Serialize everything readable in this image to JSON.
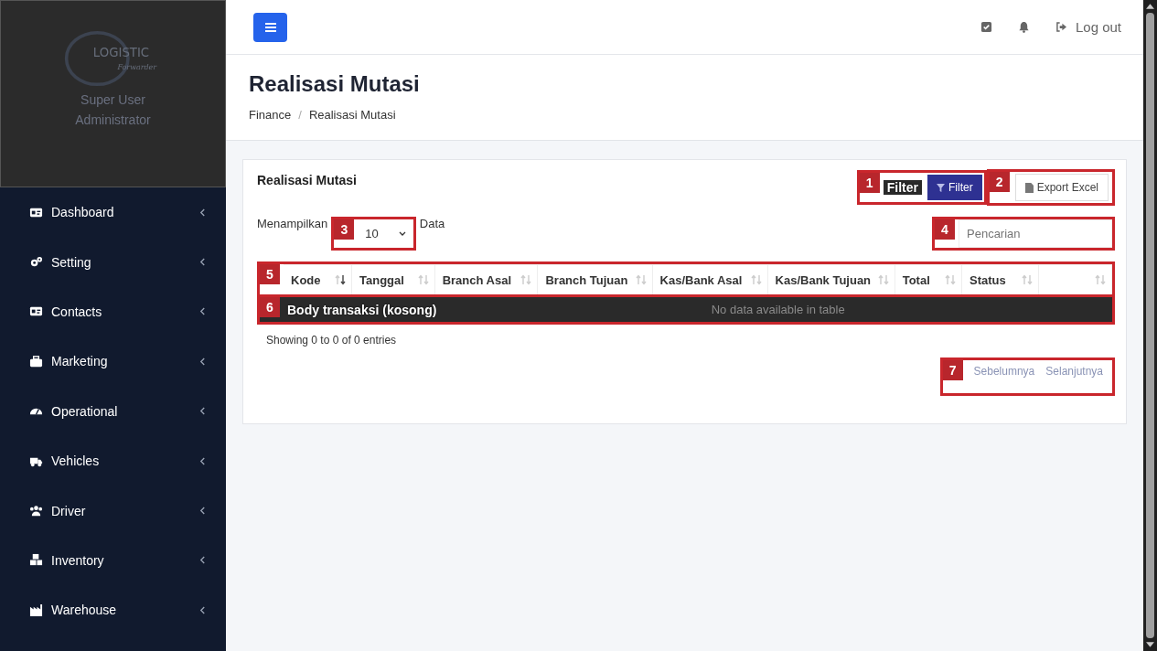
{
  "sidebar": {
    "logo_text": "LOGISTIC",
    "logo_subtext": "Forwarder",
    "user_name": "Super User",
    "user_role": "Administrator",
    "items": [
      {
        "label": "Dashboard",
        "expanded": false
      },
      {
        "label": "Setting",
        "expanded": false
      },
      {
        "label": "Contacts",
        "expanded": false
      },
      {
        "label": "Marketing",
        "expanded": false
      },
      {
        "label": "Operational",
        "expanded": false
      },
      {
        "label": "Vehicles",
        "expanded": false
      },
      {
        "label": "Driver",
        "expanded": false
      },
      {
        "label": "Inventory",
        "expanded": false
      },
      {
        "label": "Warehouse",
        "expanded": false
      }
    ]
  },
  "topbar": {
    "logout": "Log out"
  },
  "header": {
    "title": "Realisasi Mutasi",
    "breadcrumb": [
      "Finance",
      "Realisasi Mutasi"
    ],
    "separator": "/"
  },
  "card": {
    "title": "Realisasi Mutasi",
    "filter_button": "Filter",
    "export_button": "Export Excel",
    "length_prefix": "Menampilkan",
    "length_value": "10",
    "length_suffix": "Data",
    "search": {
      "placeholder": "Pencarian"
    },
    "columns": [
      {
        "label": "Kode",
        "sorted": true
      },
      {
        "label": "Tanggal",
        "sorted": false
      },
      {
        "label": "Branch Asal",
        "sorted": false
      },
      {
        "label": "Branch Tujuan",
        "sorted": false
      },
      {
        "label": "Kas/Bank Asal",
        "sorted": false
      },
      {
        "label": "Kas/Bank Tujuan",
        "sorted": false
      },
      {
        "label": "Total",
        "sorted": false
      },
      {
        "label": "Status",
        "sorted": false
      },
      {
        "sorted": false
      }
    ],
    "empty_text": "No data available in table",
    "info": "Showing 0 to 0 of 0 entries",
    "pagination": [
      {
        "label": "Sebelumnya",
        "disabled": true
      },
      {
        "label": "Selanjutnya",
        "disabled": true
      }
    ]
  },
  "annotations": [
    {
      "number": "1",
      "label": "Filter",
      "filled": false
    },
    {
      "number": "2",
      "filled": false
    },
    {
      "number": "3",
      "filled": false
    },
    {
      "number": "4",
      "filled": false
    },
    {
      "number": "5",
      "filled": false
    },
    {
      "number": "6",
      "label": "Body transaksi (kosong)",
      "filled": true
    },
    {
      "number": "7",
      "filled": false
    }
  ]
}
